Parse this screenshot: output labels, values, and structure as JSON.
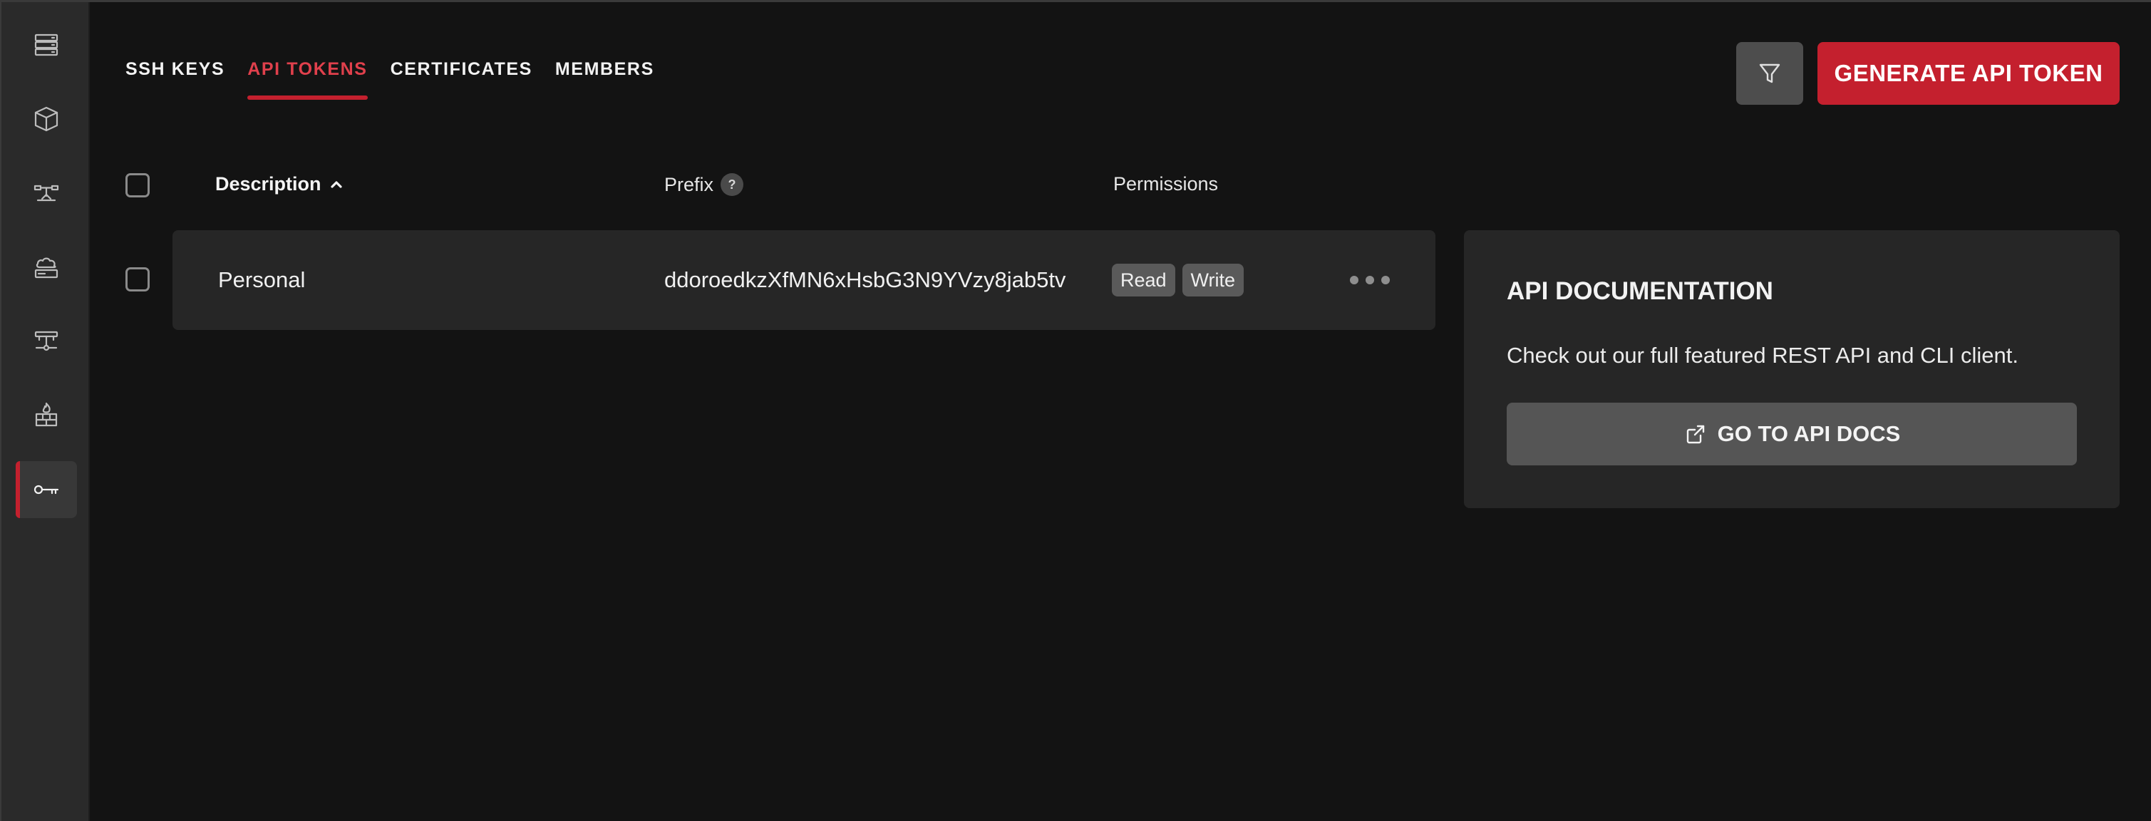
{
  "sidebar": {
    "items": [
      {
        "icon": "server-stack-icon"
      },
      {
        "icon": "cube-icon"
      },
      {
        "icon": "balancer-icon"
      },
      {
        "icon": "cloud-storage-icon"
      },
      {
        "icon": "network-icon"
      },
      {
        "icon": "firewall-icon"
      },
      {
        "icon": "key-icon",
        "active": true
      }
    ]
  },
  "tabs": [
    {
      "label": "SSH KEYS"
    },
    {
      "label": "API TOKENS",
      "active": true
    },
    {
      "label": "CERTIFICATES"
    },
    {
      "label": "MEMBERS"
    }
  ],
  "toolbar": {
    "filter_icon": "filter-icon",
    "generate_label": "GENERATE API TOKEN"
  },
  "table": {
    "columns": {
      "description": "Description",
      "prefix": "Prefix",
      "prefix_help": "?",
      "permissions": "Permissions"
    },
    "rows": [
      {
        "description": "Personal",
        "prefix": "ddoroedkzXfMN6xHsbG3N9YVzy8jab5tv",
        "permissions": [
          "Read",
          "Write"
        ]
      }
    ]
  },
  "docs": {
    "title": "API DOCUMENTATION",
    "description": "Check out our full featured REST API and CLI client.",
    "button_label": "GO TO API DOCS"
  },
  "colors": {
    "accent": "#c4202e",
    "background": "#131313",
    "sidebar": "#2a2a2a",
    "panel": "#262626"
  }
}
